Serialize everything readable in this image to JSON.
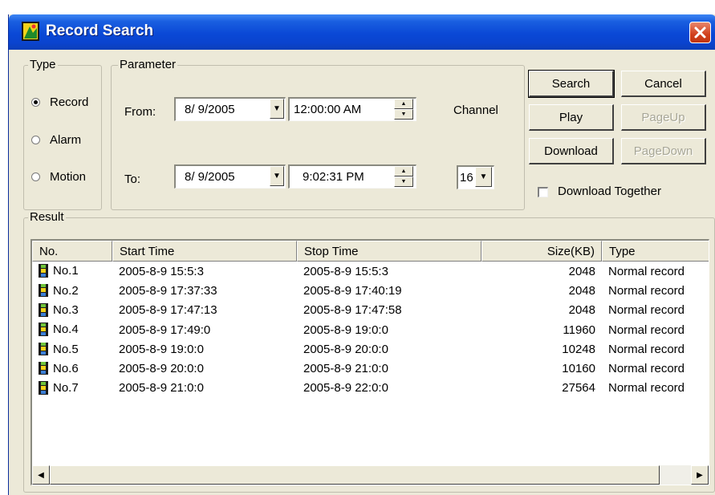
{
  "window": {
    "title": "Record Search",
    "close_glyph": "✕",
    "accent": "#0a48d6"
  },
  "type_group": {
    "legend": "Type",
    "options": [
      {
        "label": "Record",
        "checked": true
      },
      {
        "label": "Alarm",
        "checked": false
      },
      {
        "label": "Motion",
        "checked": false
      }
    ]
  },
  "parameter_group": {
    "legend": "Parameter",
    "from_label": "From:",
    "to_label": "To:",
    "from_date": "8/ 9/2005",
    "from_time": "12:00:00 AM",
    "to_date": "8/ 9/2005",
    "to_time": "9:02:31 PM",
    "channel_label": "Channel",
    "channel_value": "16"
  },
  "buttons": {
    "search": "Search",
    "cancel": "Cancel",
    "play": "Play",
    "page_up": "PageUp",
    "download": "Download",
    "page_down": "PageDown",
    "download_together": "Download Together"
  },
  "result": {
    "legend": "Result",
    "columns": [
      "No.",
      "Start Time",
      "Stop Time",
      "Size(KB)",
      "Type"
    ],
    "rows": [
      {
        "no": "No.1",
        "start": "2005-8-9 15:5:3",
        "stop": "2005-8-9 15:5:3",
        "size": "2048",
        "type": "Normal record"
      },
      {
        "no": "No.2",
        "start": "2005-8-9 17:37:33",
        "stop": "2005-8-9 17:40:19",
        "size": "2048",
        "type": "Normal record"
      },
      {
        "no": "No.3",
        "start": "2005-8-9 17:47:13",
        "stop": "2005-8-9 17:47:58",
        "size": "2048",
        "type": "Normal record"
      },
      {
        "no": "No.4",
        "start": "2005-8-9 17:49:0",
        "stop": "2005-8-9 19:0:0",
        "size": "11960",
        "type": "Normal record"
      },
      {
        "no": "No.5",
        "start": "2005-8-9 19:0:0",
        "stop": "2005-8-9 20:0:0",
        "size": "10248",
        "type": "Normal record"
      },
      {
        "no": "No.6",
        "start": "2005-8-9 20:0:0",
        "stop": "2005-8-9 21:0:0",
        "size": "10160",
        "type": "Normal record"
      },
      {
        "no": "No.7",
        "start": "2005-8-9 21:0:0",
        "stop": "2005-8-9 22:0:0",
        "size": "27564",
        "type": "Normal record"
      }
    ]
  },
  "icons": {
    "dropdown": "▼",
    "spin_up": "▲",
    "spin_down": "▼",
    "scroll_left": "◀",
    "scroll_right": "▶"
  }
}
